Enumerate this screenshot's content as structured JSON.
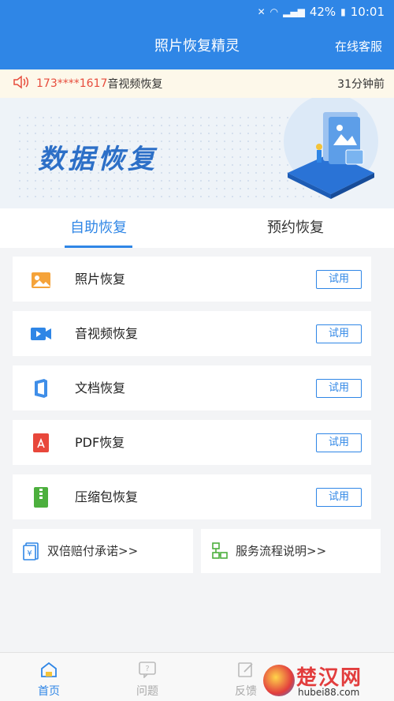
{
  "status_bar": {
    "battery": "42%",
    "time": "10:01"
  },
  "header": {
    "title": "照片恢复精灵",
    "service": "在线客服"
  },
  "notice": {
    "phone": "173****1617",
    "message": "音视频恢复",
    "time": "31分钟前"
  },
  "banner": {
    "title": "数据恢复"
  },
  "tabs": [
    {
      "label": "自助恢复",
      "active": true
    },
    {
      "label": "预约恢复",
      "active": false
    }
  ],
  "items": [
    {
      "label": "照片恢复",
      "button": "试用",
      "icon": "photo-icon"
    },
    {
      "label": "音视频恢复",
      "button": "试用",
      "icon": "video-icon"
    },
    {
      "label": "文档恢复",
      "button": "试用",
      "icon": "document-icon"
    },
    {
      "label": "PDF恢复",
      "button": "试用",
      "icon": "pdf-icon"
    },
    {
      "label": "压缩包恢复",
      "button": "试用",
      "icon": "zip-icon"
    }
  ],
  "cards": [
    {
      "label": "双倍赔付承诺>>",
      "icon": "compensation-icon"
    },
    {
      "label": "服务流程说明>>",
      "icon": "flow-icon"
    }
  ],
  "bottom_nav": [
    {
      "label": "首页",
      "icon": "home-icon",
      "active": true
    },
    {
      "label": "问题",
      "icon": "question-icon",
      "active": false
    },
    {
      "label": "反馈",
      "icon": "feedback-icon",
      "active": false
    }
  ],
  "watermark": {
    "title": "楚汉网",
    "url": "hubei88.com"
  },
  "colors": {
    "primary": "#2f86e6",
    "notice_bg": "#fdf8ea",
    "alert": "#e74c3c"
  }
}
